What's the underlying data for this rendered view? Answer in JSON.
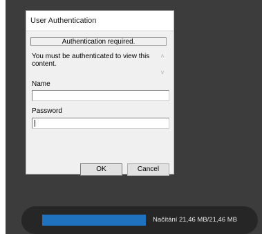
{
  "dialog": {
    "title": "User Authentication",
    "status_text": "Authentication required.",
    "message": "You must be authenticated to view this content.",
    "name_label": "Name",
    "name_value": "",
    "password_label": "Password",
    "password_value": "",
    "ok_label": "OK",
    "cancel_label": "Cancel",
    "scroll_up_icon": "chevron-up-icon",
    "scroll_down_icon": "chevron-down-icon"
  },
  "loader": {
    "text": "Načítání 21,46 MB/21,46 MB",
    "progress": 1.0,
    "bar_color": "#1e72be"
  }
}
